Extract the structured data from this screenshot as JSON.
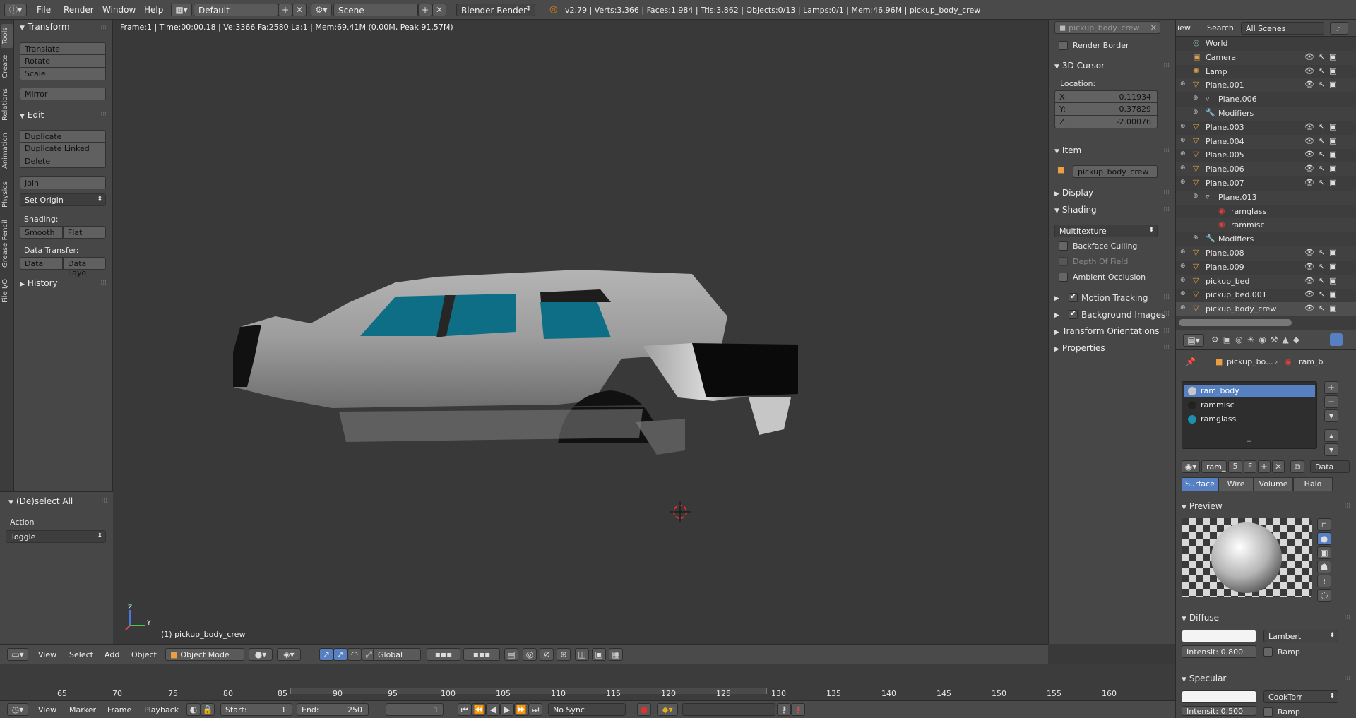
{
  "topbar": {
    "menus": [
      "File",
      "Render",
      "Window",
      "Help"
    ],
    "layout": "Default",
    "scene": "Scene",
    "engine": "Blender Render",
    "stats": "v2.79 | Verts:3,366 | Faces:1,984 | Tris:3,862 | Objects:0/13 | Lamps:0/1 | Mem:46.96M | pickup_body_crew"
  },
  "left_tabs": [
    "Tools",
    "Create",
    "Relations",
    "Animation",
    "Physics",
    "Grease Pencil",
    "File I/O"
  ],
  "toolshelf": {
    "transform_title": "Transform",
    "translate": "Translate",
    "rotate": "Rotate",
    "scale": "Scale",
    "mirror": "Mirror",
    "edit_title": "Edit",
    "duplicate": "Duplicate",
    "duplicate_linked": "Duplicate Linked",
    "delete": "Delete",
    "join": "Join",
    "set_origin": "Set Origin",
    "shading_label": "Shading:",
    "smooth": "Smooth",
    "flat": "Flat",
    "data_transfer_label": "Data Transfer:",
    "data": "Data",
    "data_layout": "Data Layo",
    "history_title": "History"
  },
  "operator_panel": {
    "title": "(De)select All",
    "action_label": "Action",
    "action_value": "Toggle"
  },
  "viewport": {
    "info": "Frame:1 | Time:00:00.18 | Ve:3366 Fa:2580 La:1 | Mem:69.41M (0.00M, Peak 91.57M)",
    "object_name": "(1) pickup_body_crew",
    "axis_x": "Y",
    "axis_z": "Z"
  },
  "viewport_header": {
    "view": "View",
    "select": "Select",
    "add": "Add",
    "object": "Object",
    "mode": "Object Mode",
    "orientation": "Global"
  },
  "npanel": {
    "search_value": "pickup_body_crew",
    "render_border": "Render Border",
    "cursor_title": "3D Cursor",
    "location_label": "Location:",
    "x_label": "X:",
    "x_value": "0.11934",
    "y_label": "Y:",
    "y_value": "0.37829",
    "z_label": "Z:",
    "z_value": "-2.00076",
    "item_title": "Item",
    "item_name": "pickup_body_crew",
    "display_title": "Display",
    "shading_title": "Shading",
    "shading_mode": "Multitexture",
    "backface": "Backface Culling",
    "depth_of_field": "Depth Of Field",
    "ambient_occlusion": "Ambient Occlusion",
    "motion_tracking": "Motion Tracking",
    "background_images": "Background Images",
    "transform_orientations": "Transform Orientations",
    "properties": "Properties"
  },
  "outliner": {
    "view": "iew",
    "search": "Search",
    "scenes": "All Scenes",
    "rows": [
      {
        "indent": 1,
        "label": "World",
        "type": "world"
      },
      {
        "indent": 1,
        "label": "Camera",
        "type": "camera"
      },
      {
        "indent": 1,
        "label": "Lamp",
        "type": "lamp"
      },
      {
        "indent": 1,
        "label": "Plane.001",
        "type": "mesh"
      },
      {
        "indent": 2,
        "label": "Plane.006",
        "type": "meshdata"
      },
      {
        "indent": 2,
        "label": "Modifiers",
        "type": "modifier"
      },
      {
        "indent": 1,
        "label": "Plane.003",
        "type": "mesh"
      },
      {
        "indent": 1,
        "label": "Plane.004",
        "type": "mesh"
      },
      {
        "indent": 1,
        "label": "Plane.005",
        "type": "mesh"
      },
      {
        "indent": 1,
        "label": "Plane.006",
        "type": "mesh"
      },
      {
        "indent": 1,
        "label": "Plane.007",
        "type": "mesh"
      },
      {
        "indent": 2,
        "label": "Plane.013",
        "type": "meshdata"
      },
      {
        "indent": 3,
        "label": "ramglass",
        "type": "material"
      },
      {
        "indent": 3,
        "label": "rammisc",
        "type": "material"
      },
      {
        "indent": 2,
        "label": "Modifiers",
        "type": "modifier"
      },
      {
        "indent": 1,
        "label": "Plane.008",
        "type": "mesh"
      },
      {
        "indent": 1,
        "label": "Plane.009",
        "type": "mesh"
      },
      {
        "indent": 1,
        "label": "pickup_bed",
        "type": "mesh"
      },
      {
        "indent": 1,
        "label": "pickup_bed.001",
        "type": "mesh"
      },
      {
        "indent": 1,
        "label": "pickup_body_crew",
        "type": "mesh"
      }
    ]
  },
  "props": {
    "breadcrumb_object": "pickup_bo...",
    "breadcrumb_material": "ram_b",
    "materials": [
      {
        "name": "ram_body",
        "color": "#c8c8c8"
      },
      {
        "name": "rammisc",
        "color": "#222222"
      },
      {
        "name": "ramglass",
        "color": "#1d8fb0"
      }
    ],
    "mat_name": "ram_",
    "mat_users": "5",
    "mat_fake": "F",
    "link": "Data",
    "tabs": [
      "Surface",
      "Wire",
      "Volume",
      "Halo"
    ],
    "preview_title": "Preview",
    "diffuse_title": "Diffuse",
    "diffuse_shader": "Lambert",
    "intensity_label": "Intensit:",
    "intensity_value": "0.800",
    "ramp": "Ramp",
    "specular_title": "Specular",
    "specular_shader": "CookTorr",
    "spec_intensity": "Intensit: 0.500",
    "spec_ramp": "Ramp"
  },
  "timeline": {
    "ticks": [
      "65",
      "70",
      "75",
      "80",
      "85",
      "90",
      "95",
      "100",
      "105",
      "110",
      "115",
      "120",
      "125",
      "130",
      "135",
      "140",
      "145",
      "150",
      "155",
      "160"
    ],
    "view": "View",
    "marker": "Marker",
    "frame": "Frame",
    "playback": "Playback",
    "start_label": "Start:",
    "start_value": "1",
    "end_label": "End:",
    "end_value": "250",
    "current": "1",
    "sync": "No Sync"
  },
  "colors": {
    "accent": "#5680c2",
    "glass": "#0e6e86",
    "body": "#9a9a9a"
  }
}
